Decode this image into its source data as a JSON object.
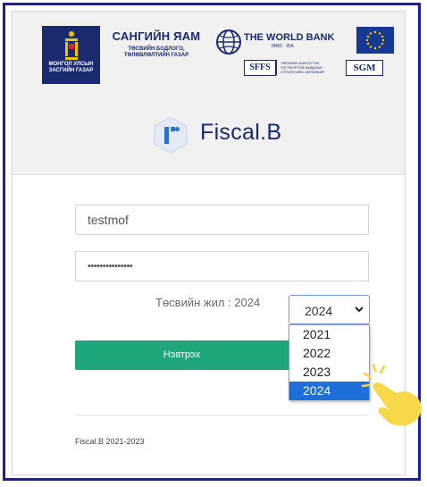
{
  "logos": {
    "emblem_caption": "МОНГОЛ УЛСЫН ЗАСГИЙН ГАЗАР",
    "ministry_title": "САНГИЙН ЯАМ",
    "ministry_subtitle": "ТӨСВИЙН БОДЛОГО, ТӨЛӨВЛӨЛТИЙН ГАЗАР",
    "worldbank_title": "THE WORLD BANK",
    "worldbank_subtitle": "IBRD · IDA",
    "sfsf_label": "SFFS",
    "sfsf_note": "ТӨСВИЙН ШИНЭТГЭЛ, ТОГТВОРТОЙ БАЙДЛЫН СТРАТЕГИЙН ХӨТӨЛБӨР",
    "sgm_label": "SGM"
  },
  "brand": {
    "name": "Fiscal.B",
    "color": "#1b2a6e",
    "icon_color": "#2a73c9"
  },
  "form": {
    "username_value": "testmof",
    "password_value": "•••••••••••••••",
    "year_label": "Төсвийн жил : 2024",
    "year_selected": "2024",
    "year_options": [
      "2021",
      "2022",
      "2023",
      "2024"
    ],
    "login_button": "Нэвтрэх"
  },
  "footer": {
    "text": "Fiscal.B 2021-2023"
  },
  "colors": {
    "accent_green": "#20a67d",
    "selection_blue": "#1e6fd9",
    "frame_blue": "#1f1ba3"
  }
}
